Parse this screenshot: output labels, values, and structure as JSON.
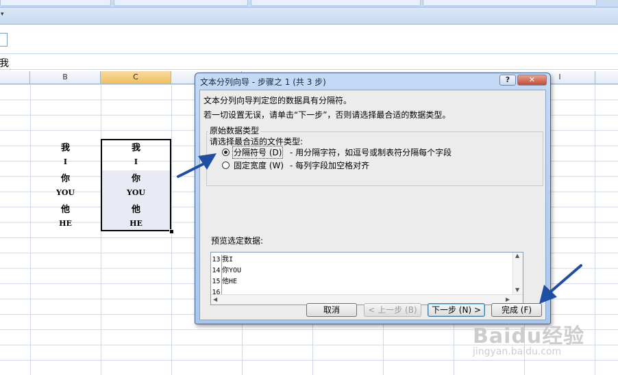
{
  "formula_bar": {
    "content": "我"
  },
  "columns": [
    {
      "label": "B",
      "selected": false
    },
    {
      "label": "C",
      "selected": true
    },
    {
      "label": "I",
      "selected": false
    }
  ],
  "cells": {
    "b1": {
      "zh": "我",
      "en": "I"
    },
    "b2": {
      "zh": "你",
      "en": "YOU"
    },
    "b3": {
      "zh": "他",
      "en": "HE"
    },
    "c1": {
      "zh": "我",
      "en": "I"
    },
    "c2": {
      "zh": "你",
      "en": "YOU"
    },
    "c3": {
      "zh": "他",
      "en": "HE"
    }
  },
  "dialog": {
    "title": "文本分列向导 - 步骤之 1 (共 3 步)",
    "help_label": "?",
    "close_label": "✕",
    "intro_line1": "文本分列向导判定您的数据具有分隔符。",
    "intro_line2": "若一切设置无误，请单击“下一步”，否则请选择最合适的数据类型。",
    "group_title": "原始数据类型",
    "prompt": "请选择最合适的文件类型:",
    "options": [
      {
        "label": "分隔符号 (D)",
        "desc": "- 用分隔字符，如逗号或制表符分隔每个字段",
        "selected": true
      },
      {
        "label": "固定宽度 (W)",
        "desc": "- 每列字段加空格对齐",
        "selected": false
      }
    ],
    "preview_label": "预览选定数据:",
    "preview_rows": [
      {
        "num": "13",
        "text": "我I"
      },
      {
        "num": "14",
        "text": "你YOU"
      },
      {
        "num": "15",
        "text": "他HE"
      },
      {
        "num": "16",
        "text": ""
      }
    ],
    "buttons": {
      "cancel": "取消",
      "back": "< 上一步 (B)",
      "next": "下一步 (N) >",
      "finish": "完成 (F)"
    }
  },
  "watermark": {
    "main": "Baidu经验",
    "sub": "jingyan.baidu.com"
  },
  "colors": {
    "selection_fill": "#e8ebf4",
    "dialog_frame": "#a9c6ec",
    "arrow": "#1f4fa3"
  }
}
